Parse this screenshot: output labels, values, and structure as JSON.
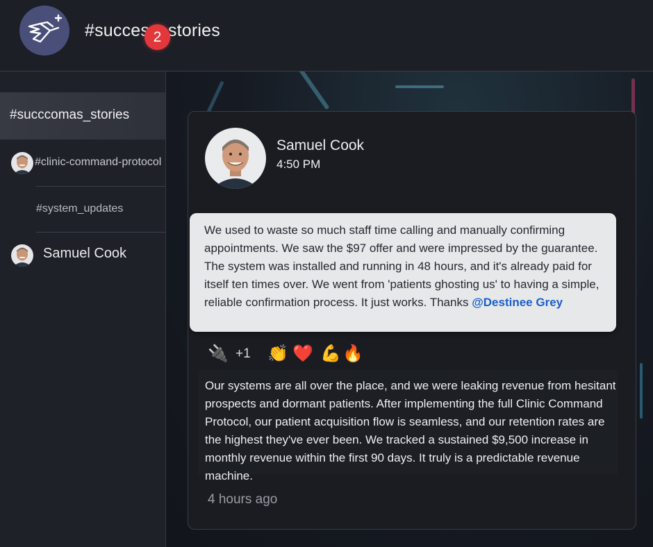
{
  "header": {
    "title": "#success_stories",
    "logo_icon": "dove-plus-icon",
    "logo_bg": "#4a4f7a"
  },
  "sidebar": {
    "active_channel": {
      "label": "#succcomas_stories",
      "badge": "2",
      "badge_color": "#e2383b"
    },
    "items": [
      {
        "label": "#clinic-command-protocol",
        "has_avatar": true
      },
      {
        "label": "#system_updates",
        "has_avatar": false
      },
      {
        "label": "Samuel Cook",
        "has_avatar": true
      }
    ]
  },
  "post": {
    "author": "Samuel Cook",
    "time": "4:50 PM",
    "message_text": "We used to waste so much staff time calling and manually confirming appointments. We saw the $97 offer and were impressed by the guarantee. The system was installed and running in 48 hours, and it's already paid for itself ten times over. We went from 'patients ghosting us' to having a simple, reliable confirmation process. It just works. Thanks",
    "mention": "@Destinee Grey",
    "reactions": {
      "first_icon": "lightning-plug-icon",
      "first_emoji": "🔌",
      "count": "+1",
      "emojis": [
        "👏",
        "❤️",
        "💪",
        "🔥"
      ]
    },
    "second_message": "Our systems are all over the place, and we were leaking revenue from hesitant prospects and dormant patients. After implementing the full Clinic Command Protocol, our patient acquisition flow is seamless, and our retention rates are the highest they've ever been. We tracked a sustained $9,500 increase in monthly revenue within the first 90 days. It truly is a predictable revenue machine.",
    "posted_ago": "4 hours ago"
  }
}
